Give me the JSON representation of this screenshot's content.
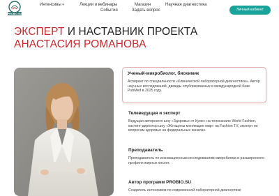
{
  "header": {
    "logo_text": "PROBIO.SU",
    "nav": [
      {
        "label": "Интенсивы",
        "dropdown": true
      },
      {
        "label": "Лекции и вебинары",
        "dropdown": false
      },
      {
        "label": "События",
        "dropdown": false
      },
      {
        "label": "Магазин",
        "dropdown": false
      },
      {
        "label": "Задать вопрос",
        "dropdown": false
      },
      {
        "label": "Научная диагностика",
        "dropdown": false
      }
    ],
    "cta_label": "Личный кабинет"
  },
  "hero": {
    "title_line1_red": "ЭКСПЕРТ",
    "title_line1_dark": " И НАСТАВНИК ПРОЕКТА",
    "title_line2_red": "АНАСТАСИЯ РОМАНОВА"
  },
  "cards": [
    {
      "heading": "Ученый-микробиолог, биохимик",
      "text": "Аспирант по специальности «Клинической лабораторной диагностика». Автор научных исследований, дважды опубликованных в международной базе PubMed в 2025 году."
    },
    {
      "heading": "Телеведущая и эксперт",
      "text": "Ведущая авторского шоу «Здоровье от Кукю» на телеканале World Fashion, кастинг-директор шоу «Женщины меняющие мир» на Fashion TV, эксперт по вопросам здоровья на федеральных каналах."
    },
    {
      "heading": "Преподаватель",
      "text": "Преподаватель по инновационным исследованиям микробиома и расширенного профиля жирных кислот."
    },
    {
      "heading": "Автор программ PROBIO.SU",
      "text": "Создатель интенсивов по современной лабораторной диагностике"
    }
  ],
  "colors": {
    "accent_red": "#c8282b",
    "accent_teal": "#1aa39a",
    "card_border": "#e7a9a9"
  }
}
